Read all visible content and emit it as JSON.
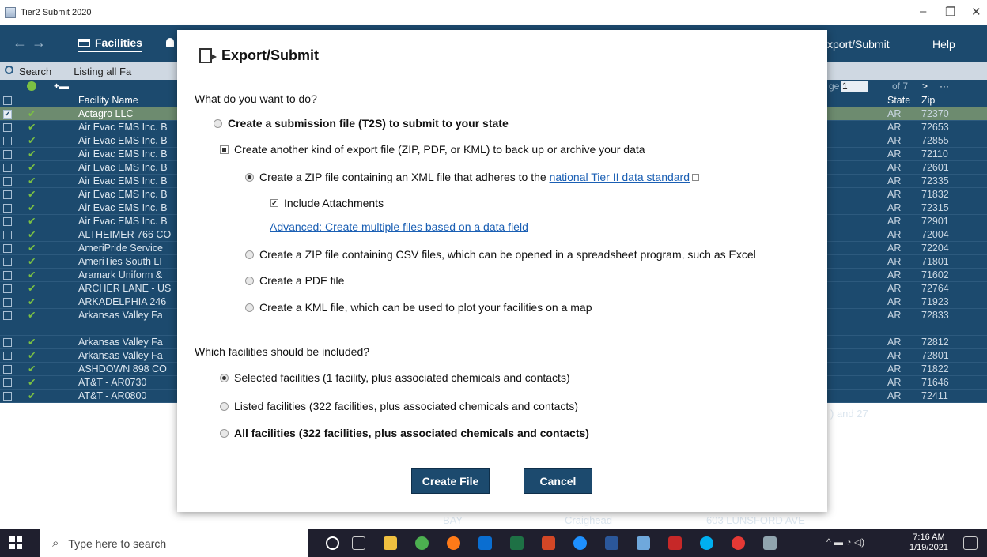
{
  "window": {
    "title": "Tier2 Submit 2020",
    "minimize": "–",
    "maximize": "❐",
    "close": "✕"
  },
  "nav": {
    "back": "←",
    "forward": "→",
    "facilities": "Facilities",
    "export_submit": "xport/Submit",
    "help": "Help"
  },
  "search": {
    "label": "Search",
    "listing": "Listing all Fa"
  },
  "grid": {
    "page_label": "ge",
    "page_value": "1",
    "of_pages": "of 7",
    "next": ">",
    "more": "···",
    "columns": {
      "facility_name": "Facility Name",
      "state": "State",
      "zip": "Zip"
    },
    "rows": [
      {
        "name": "Actagro LLC",
        "state": "AR",
        "zip": "72370",
        "selected": true
      },
      {
        "name": "Air Evac EMS Inc. B",
        "state": "AR",
        "zip": "72653"
      },
      {
        "name": "Air Evac EMS Inc. B",
        "state": "AR",
        "zip": "72855"
      },
      {
        "name": "Air Evac EMS Inc. B",
        "state": "AR",
        "zip": "72110"
      },
      {
        "name": "Air Evac EMS Inc. B",
        "state": "AR",
        "zip": "72601"
      },
      {
        "name": "Air Evac EMS Inc. B",
        "state": "AR",
        "zip": "72335"
      },
      {
        "name": "Air Evac EMS Inc. B",
        "state": "AR",
        "zip": "71832"
      },
      {
        "name": "Air Evac EMS Inc. B",
        "state": "AR",
        "zip": "72315"
      },
      {
        "name": "Air Evac EMS Inc. B",
        "state": "AR",
        "zip": "72901"
      },
      {
        "name": "ALTHEIMER 766 CO",
        "state": "AR",
        "zip": "72004"
      },
      {
        "name": "AmeriPride Service",
        "state": "AR",
        "zip": "72204"
      },
      {
        "name": "AmeriTies South LI",
        "state": "AR",
        "zip": "71801"
      },
      {
        "name": "Aramark Uniform &",
        "state": "AR",
        "zip": "71602"
      },
      {
        "name": "ARCHER LANE - US",
        "state": "AR",
        "zip": "72764"
      },
      {
        "name": "ARKADELPHIA 246",
        "state": "AR",
        "zip": "71923"
      },
      {
        "name": "Arkansas Valley Fa",
        "state": "AR",
        "zip": "72833",
        "extra": ") and 27",
        "tall": true
      },
      {
        "name": "Arkansas Valley Fa",
        "state": "AR",
        "zip": "72812"
      },
      {
        "name": "Arkansas Valley Fa",
        "state": "AR",
        "zip": "72801"
      },
      {
        "name": "ASHDOWN 898 CO",
        "state": "AR",
        "zip": "71822"
      },
      {
        "name": "AT&T - AR0730",
        "state": "AR",
        "zip": "71646"
      },
      {
        "name": "AT&T - AR0800",
        "state": "AR",
        "zip": "72411",
        "city": "BAY",
        "county": "Craighead",
        "street": "603 LUNSFORD AVE"
      }
    ]
  },
  "dialog": {
    "title": "Export/Submit",
    "question1": "What do you want to do?",
    "opt_t2s": "Create a submission file (T2S) to submit to your state",
    "opt_other": "Create another kind of export file (ZIP, PDF, or KML) to back up or archive your data",
    "opt_xml_prefix": "Create a ZIP file containing an XML file that adheres to the ",
    "opt_xml_link": "national Tier II data standard",
    "include_attachments": "Include Attachments",
    "advanced_link": "Advanced: Create multiple files based on a data field",
    "opt_csv": "Create a ZIP file containing CSV files, which can be opened in a spreadsheet program, such as Excel",
    "opt_pdf": "Create a PDF file",
    "opt_kml": "Create a KML file, which can be used to plot your facilities on a map",
    "question2": "Which facilities should be included?",
    "fac_selected": "Selected facilities (1 facility, plus associated chemicals and contacts)",
    "fac_listed": "Listed facilities (322 facilities, plus associated chemicals and contacts)",
    "fac_all": "All facilities (322 facilities, plus associated chemicals and contacts)",
    "create_btn": "Create File",
    "cancel_btn": "Cancel"
  },
  "taskbar": {
    "search_placeholder": "Type here to search",
    "time": "7:16 AM",
    "date": "1/19/2021"
  }
}
